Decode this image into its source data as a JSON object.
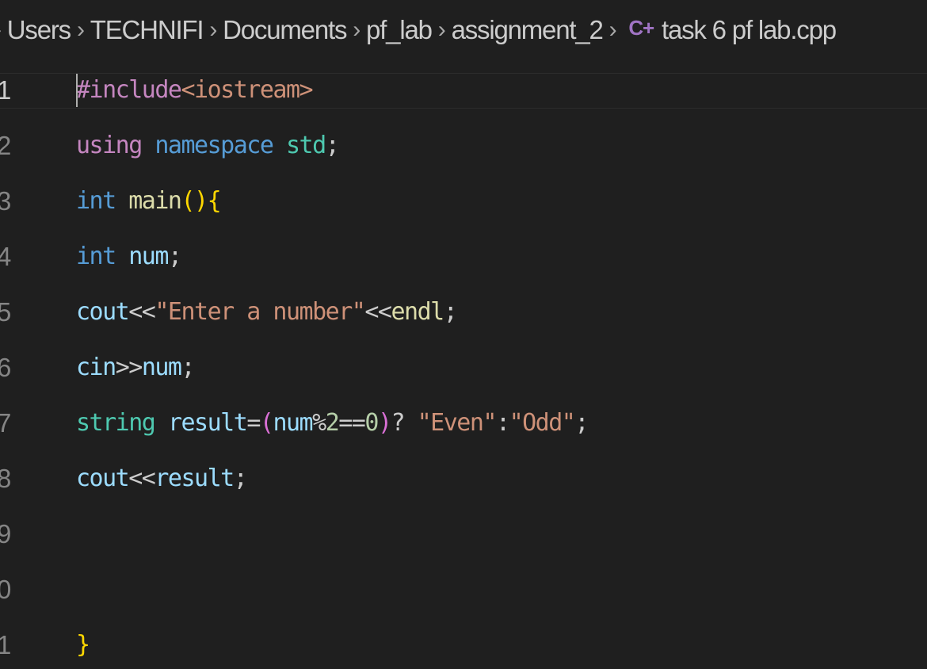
{
  "breadcrumb": {
    "leading_separator": "›",
    "items": [
      "Users",
      "TECHNIFI",
      "Documents",
      "pf_lab",
      "assignment_2"
    ],
    "separator": "›",
    "file": {
      "icon": "cpp-file-icon",
      "icon_glyph": "C+",
      "name": "task 6 pf lab.cpp"
    }
  },
  "editor": {
    "language": "cpp",
    "active_line": 1,
    "lines": [
      {
        "number": "1",
        "tokens": [
          {
            "text": "#include",
            "type": "directive"
          },
          {
            "text": "<iostream>",
            "type": "include"
          }
        ]
      },
      {
        "number": "2",
        "tokens": [
          {
            "text": "using",
            "type": "directive"
          },
          {
            "text": " ",
            "type": "plain"
          },
          {
            "text": "namespace",
            "type": "keyword"
          },
          {
            "text": " ",
            "type": "plain"
          },
          {
            "text": "std",
            "type": "namespace"
          },
          {
            "text": ";",
            "type": "plain"
          }
        ]
      },
      {
        "number": "3",
        "tokens": [
          {
            "text": "int",
            "type": "keyword"
          },
          {
            "text": " ",
            "type": "plain"
          },
          {
            "text": "main",
            "type": "func"
          },
          {
            "text": "()",
            "type": "bracket1"
          },
          {
            "text": "{",
            "type": "bracket1"
          }
        ]
      },
      {
        "number": "4",
        "tokens": [
          {
            "text": "int",
            "type": "keyword"
          },
          {
            "text": " ",
            "type": "plain"
          },
          {
            "text": "num",
            "type": "var"
          },
          {
            "text": ";",
            "type": "plain"
          }
        ]
      },
      {
        "number": "5",
        "tokens": [
          {
            "text": "cout",
            "type": "var"
          },
          {
            "text": "<<",
            "type": "plain"
          },
          {
            "text": "\"Enter a number\"",
            "type": "string"
          },
          {
            "text": "<<",
            "type": "plain"
          },
          {
            "text": "endl",
            "type": "func"
          },
          {
            "text": ";",
            "type": "plain"
          }
        ]
      },
      {
        "number": "6",
        "tokens": [
          {
            "text": "cin",
            "type": "var"
          },
          {
            "text": ">>",
            "type": "plain"
          },
          {
            "text": "num",
            "type": "var"
          },
          {
            "text": ";",
            "type": "plain"
          }
        ]
      },
      {
        "number": "7",
        "tokens": [
          {
            "text": "string",
            "type": "namespace"
          },
          {
            "text": " ",
            "type": "plain"
          },
          {
            "text": "result",
            "type": "var"
          },
          {
            "text": "=",
            "type": "plain"
          },
          {
            "text": "(",
            "type": "bracket2"
          },
          {
            "text": "num",
            "type": "var"
          },
          {
            "text": "%",
            "type": "plain"
          },
          {
            "text": "2",
            "type": "number"
          },
          {
            "text": "==",
            "type": "plain"
          },
          {
            "text": "0",
            "type": "number"
          },
          {
            "text": ")",
            "type": "bracket2"
          },
          {
            "text": "? ",
            "type": "plain"
          },
          {
            "text": "\"Even\"",
            "type": "string"
          },
          {
            "text": ":",
            "type": "plain"
          },
          {
            "text": "\"Odd\"",
            "type": "string"
          },
          {
            "text": ";",
            "type": "plain"
          }
        ]
      },
      {
        "number": "8",
        "tokens": [
          {
            "text": "cout",
            "type": "var"
          },
          {
            "text": "<<",
            "type": "plain"
          },
          {
            "text": "result",
            "type": "var"
          },
          {
            "text": ";",
            "type": "plain"
          }
        ]
      },
      {
        "number": "9",
        "tokens": []
      },
      {
        "number": "0",
        "tokens": []
      },
      {
        "number": "1",
        "tokens": [
          {
            "text": "}",
            "type": "bracket1"
          }
        ]
      }
    ]
  },
  "colors": {
    "background": "#1f1f1f",
    "plain": "#cccccc",
    "keyword": "#569cd6",
    "directive": "#c586c0",
    "include": "#ce9178",
    "namespace": "#4ec9b0",
    "func": "#dcdcaa",
    "var": "#9cdcfe",
    "string": "#ce9178",
    "number": "#b5cea8",
    "bracket1": "#ffd700",
    "bracket2": "#da70d6"
  }
}
